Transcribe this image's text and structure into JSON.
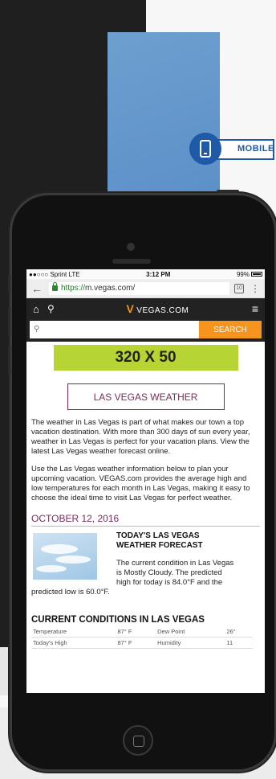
{
  "badge": {
    "label": "MOBILE"
  },
  "status_bar": {
    "carrier": "●●○○○ Sprint  LTE",
    "time": "3:12 PM",
    "battery": "99%"
  },
  "browser": {
    "url_https": "https://",
    "url_domain": "m.vegas.com/",
    "tabs_count": "10"
  },
  "site": {
    "logo": "VEGAS.COM",
    "search_placeholder": "",
    "search_button": "SEARCH",
    "ad_label": "320 X 50",
    "weather_button": "LAS VEGAS WEATHER",
    "intro_paragraph": "The weather in Las Vegas is part of what makes our town a top vacation destination. With more than 300 days of sun every year, weather in Las Vegas is perfect for your vacation plans. View the latest Las Vegas weather forecast online.",
    "info_paragraph": "Use the Las Vegas weather information below to plan your upcoming vacation. VEGAS.com provides the average high and low temperatures for each month in Las Vegas, making it easy to choose the ideal time to visit Las Vegas for perfect weather.",
    "date": "OCTOBER 12, 2016",
    "forecast_title_1": "TODAY'S LAS VEGAS",
    "forecast_title_2": "WEATHER FORECAST",
    "forecast_text_1": "The current condition in Las Vegas",
    "forecast_text_2": "is Mostly Cloudy. The predicted",
    "forecast_text_3": "high for today is 84.0°F and the",
    "forecast_text_4": "predicted low is 60.0°F.",
    "conditions_heading": "CURRENT CONDITIONS IN LAS VEGAS",
    "conditions": {
      "rows": [
        [
          "Temperature",
          "87° F",
          "Dew Point",
          "26°"
        ],
        [
          "Today's High",
          "87° F",
          "Humidity",
          "11"
        ]
      ]
    }
  }
}
